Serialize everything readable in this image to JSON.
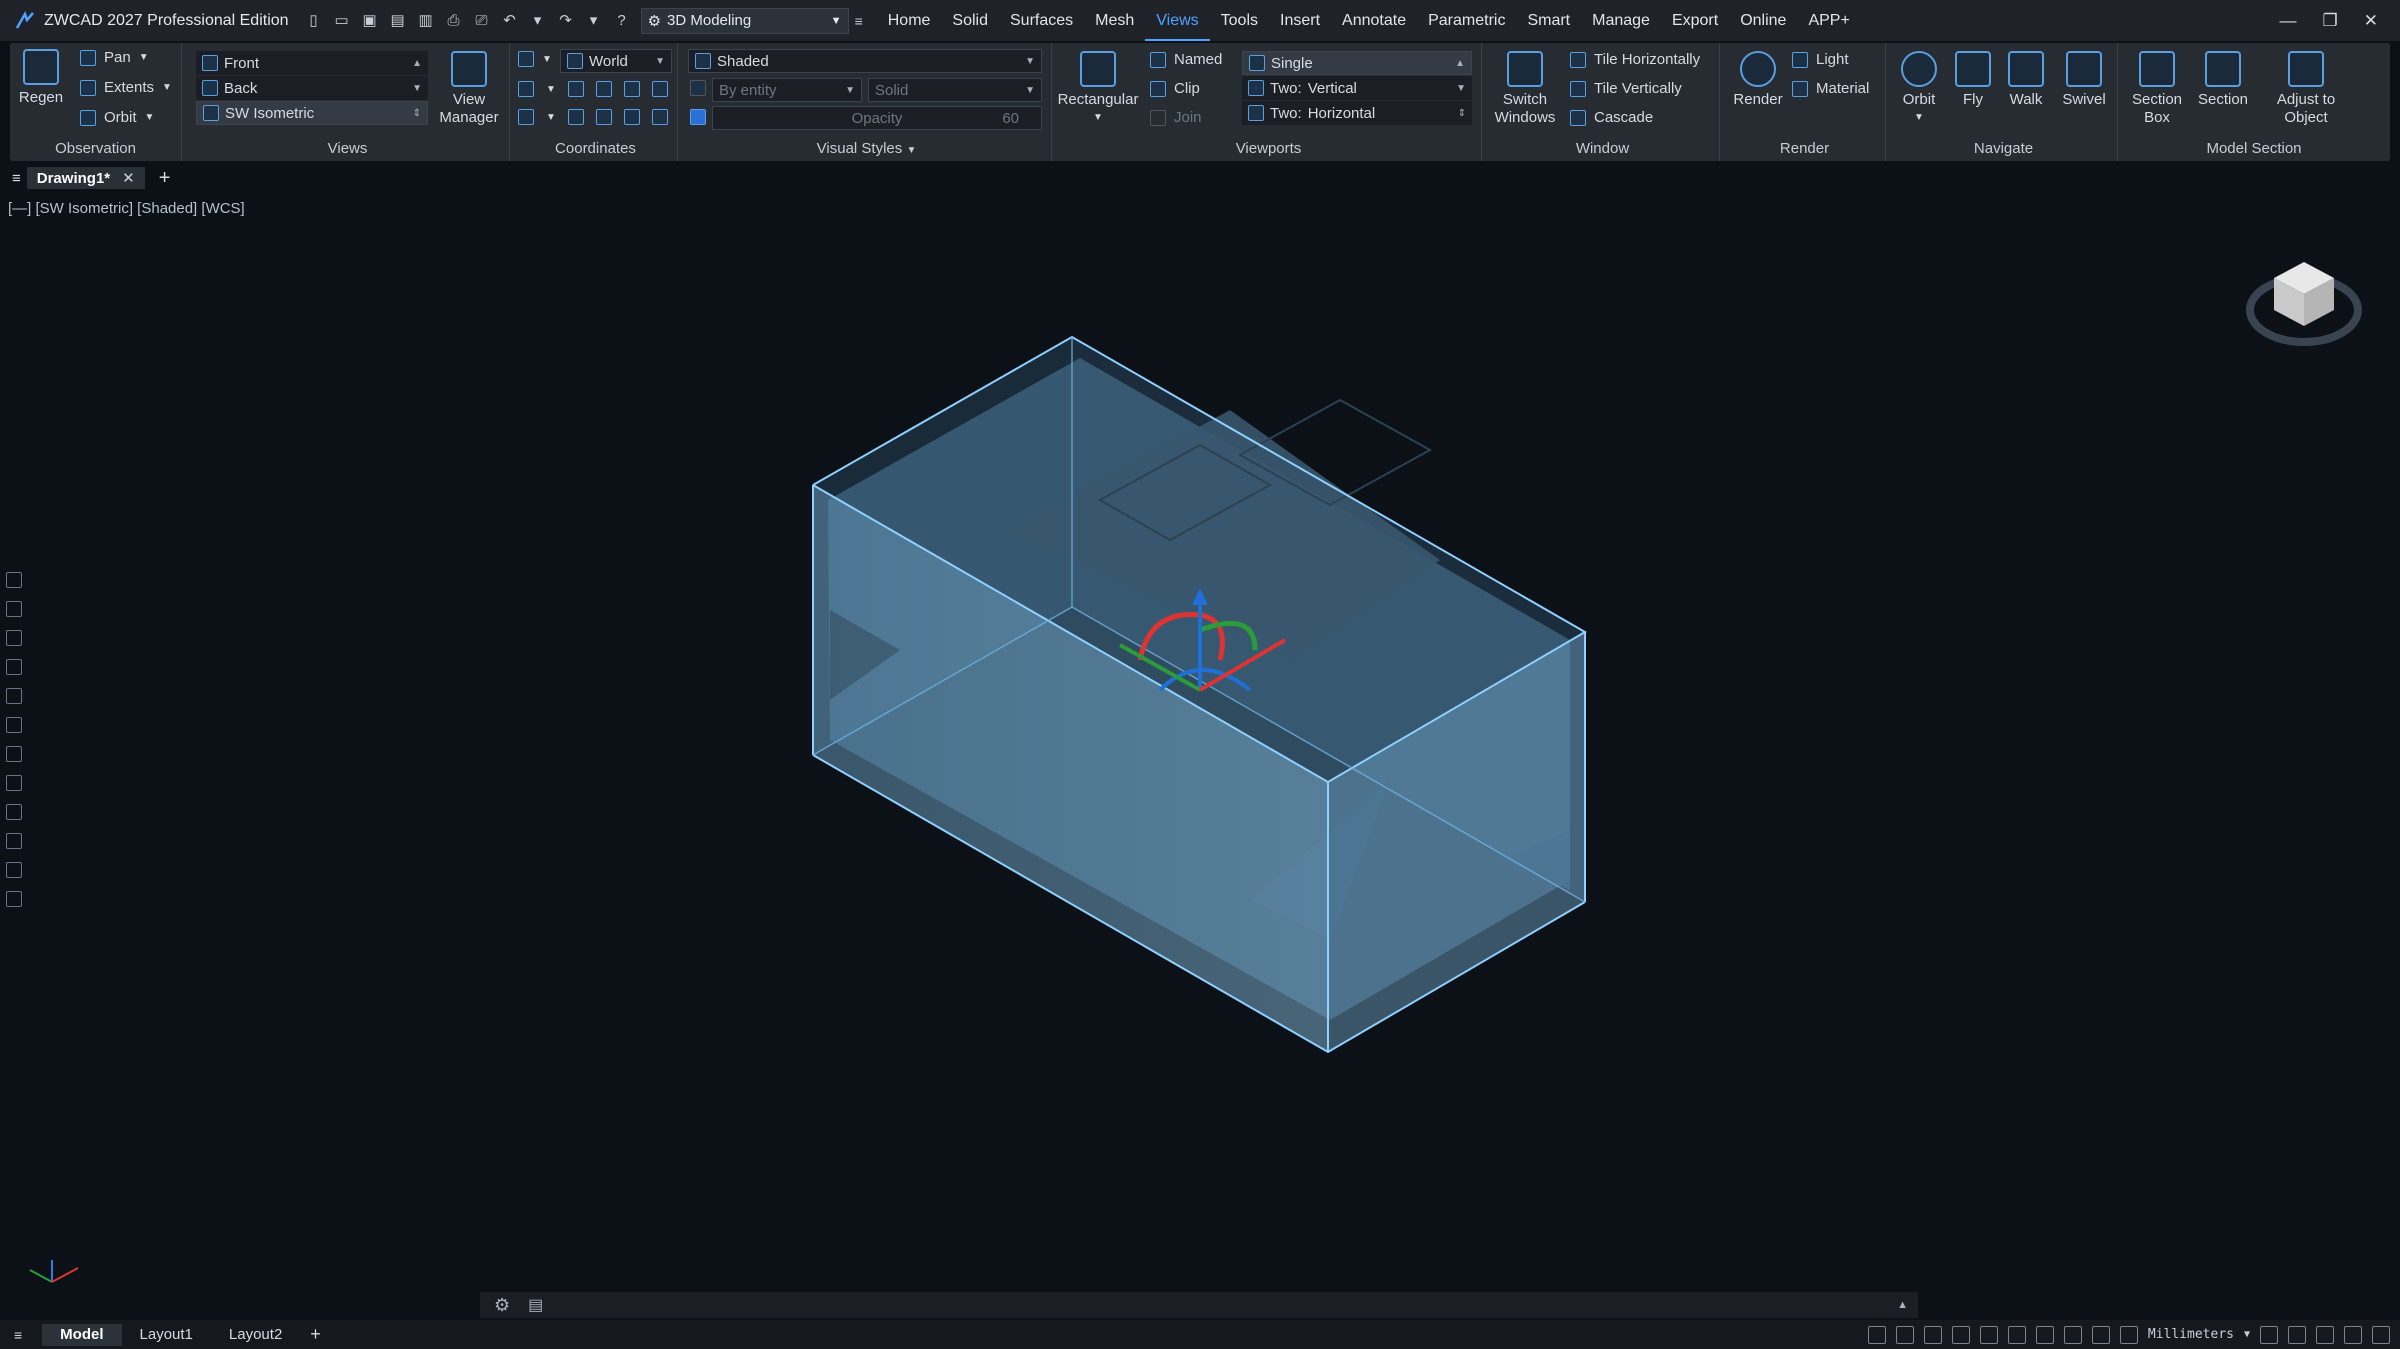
{
  "app": {
    "title": "ZWCAD 2027 Professional Edition"
  },
  "workspace": {
    "selected": "3D Modeling"
  },
  "menu": [
    "Home",
    "Solid",
    "Surfaces",
    "Mesh",
    "Views",
    "Tools",
    "Insert",
    "Annotate",
    "Parametric",
    "Smart",
    "Manage",
    "Export",
    "Online",
    "APP+"
  ],
  "menu_active": "Views",
  "ribbon": {
    "observation": {
      "title": "Observation",
      "regen": "Regen",
      "pan": "Pan",
      "extents": "Extents",
      "orbit": "Orbit"
    },
    "views": {
      "title": "Views",
      "items": [
        "Front",
        "Back",
        "SW Isometric"
      ],
      "view_manager": "View Manager"
    },
    "coordinates": {
      "title": "Coordinates",
      "ucs": "World"
    },
    "visual_styles": {
      "title": "Visual Styles",
      "style": "Shaded",
      "color": "By entity",
      "face": "Solid",
      "opacity_label": "Opacity",
      "opacity_value": "60"
    },
    "viewports": {
      "title": "Viewports",
      "rectangular": "Rectangular",
      "named": "Named",
      "clip": "Clip",
      "join": "Join",
      "config": "Single",
      "two_vertical_a": "Two:",
      "two_vertical_b": "Vertical",
      "two_horizontal_a": "Two:",
      "two_horizontal_b": "Horizontal"
    },
    "window": {
      "title": "Window",
      "switch": "Switch Windows",
      "tile_h": "Tile Horizontally",
      "tile_v": "Tile Vertically",
      "cascade": "Cascade"
    },
    "render": {
      "title": "Render",
      "render": "Render",
      "light": "Light",
      "material": "Material"
    },
    "navigate": {
      "title": "Navigate",
      "orbit": "Orbit",
      "fly": "Fly",
      "walk": "Walk",
      "swivel": "Swivel"
    },
    "model_section": {
      "title": "Model Section",
      "section_box": "Section Box",
      "section": "Section",
      "adjust": "Adjust to Object"
    }
  },
  "document": {
    "tab": "Drawing1*"
  },
  "viewport": {
    "label": "[—] [SW Isometric] [Shaded] [WCS]"
  },
  "layout_tabs": [
    "Model",
    "Layout1",
    "Layout2"
  ],
  "layout_active": "Model",
  "status": {
    "units": "Millimeters"
  },
  "colors": {
    "accent": "#4ea3ff",
    "background": "#0b1117",
    "ribbon": "#272c33",
    "box_edge": "#8fd0ff"
  }
}
